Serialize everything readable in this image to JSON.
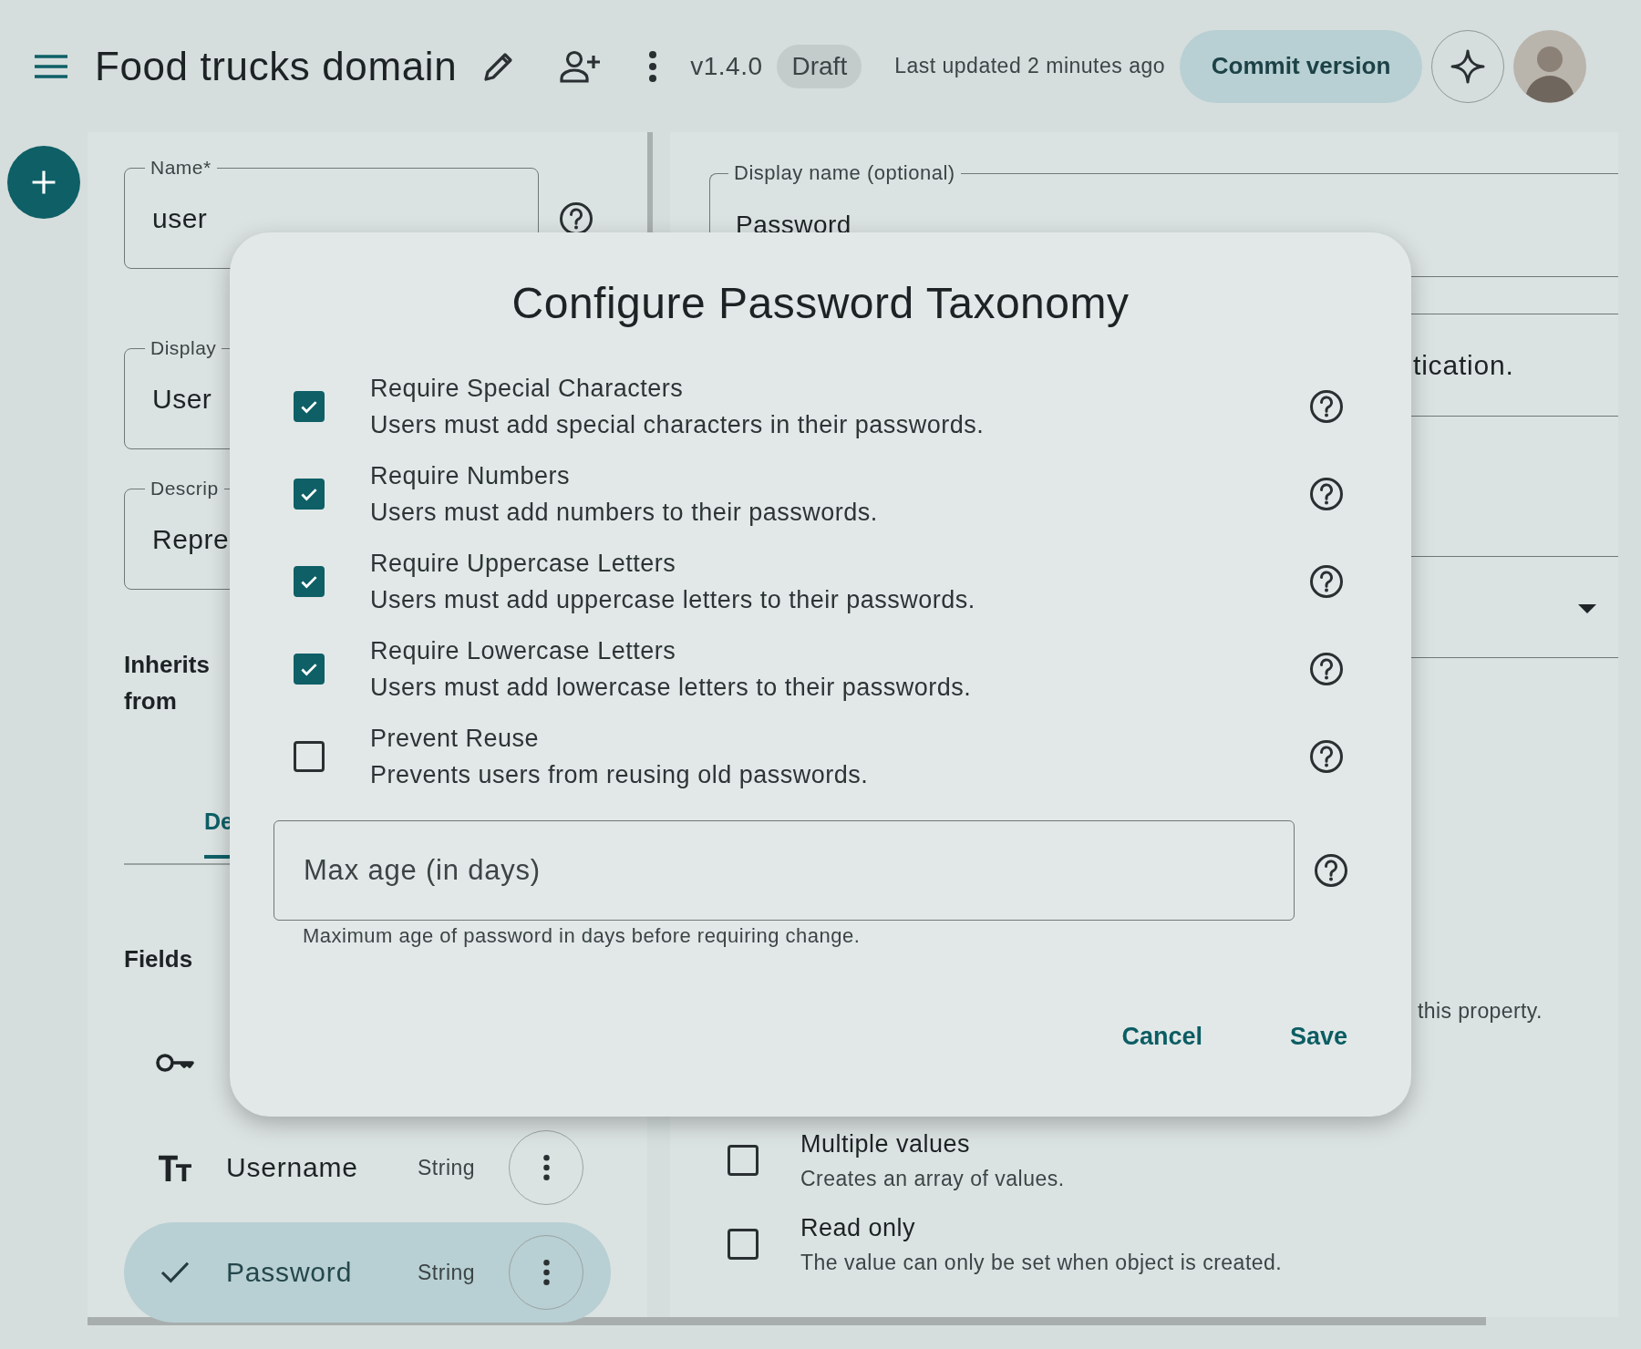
{
  "header": {
    "title": "Food trucks domain",
    "version": "v1.4.0",
    "status": "Draft",
    "last_updated": "Last updated 2 minutes ago",
    "commit_button": "Commit version"
  },
  "left_panel": {
    "fields": [
      {
        "kind": "with_help",
        "label": "Name*",
        "value": "user"
      },
      {
        "kind": "plain",
        "label": "Display",
        "value": "User"
      },
      {
        "kind": "plain",
        "label": "Descrip",
        "value": "Repre"
      }
    ],
    "inherits_label": "Inherits from",
    "tab": {
      "label": "De",
      "selected": true
    },
    "fields_heading": "Fields",
    "field_list": [
      {
        "kind": "key",
        "selected": false
      },
      {
        "kind": "text",
        "name": "Username",
        "type": "String",
        "selected": false
      },
      {
        "name": "Password",
        "type": "String",
        "selected": true
      }
    ]
  },
  "right_panel": {
    "display_name": {
      "label": "Display name (optional)",
      "value": "Password"
    },
    "description_fragment": "tication.",
    "hint_fragment": "this property.",
    "options": [
      {
        "title": "Multiple values",
        "description": "Creates an array of values.",
        "checked": false
      },
      {
        "title": "Read only",
        "description": "The value can only be set when object is created.",
        "checked": false
      }
    ]
  },
  "dialog": {
    "title": "Configure Password Taxonomy",
    "options": [
      {
        "title": "Require Special Characters",
        "description": "Users must add special characters in their passwords.",
        "checked": true
      },
      {
        "title": "Require Numbers",
        "description": "Users must add numbers to their passwords.",
        "checked": true
      },
      {
        "title": "Require Uppercase Letters",
        "description": "Users must add uppercase letters to their passwords.",
        "checked": true
      },
      {
        "title": "Require Lowercase Letters",
        "description": "Users must add lowercase letters to their passwords.",
        "checked": true
      },
      {
        "title": "Prevent Reuse",
        "description": "Prevents users from reusing old passwords.",
        "checked": false
      }
    ],
    "max_age": {
      "placeholder": "Max age (in days)",
      "helper": "Maximum age of password in days before requiring change."
    },
    "buttons": [
      {
        "label": "Cancel"
      },
      {
        "label": "Save"
      }
    ]
  }
}
